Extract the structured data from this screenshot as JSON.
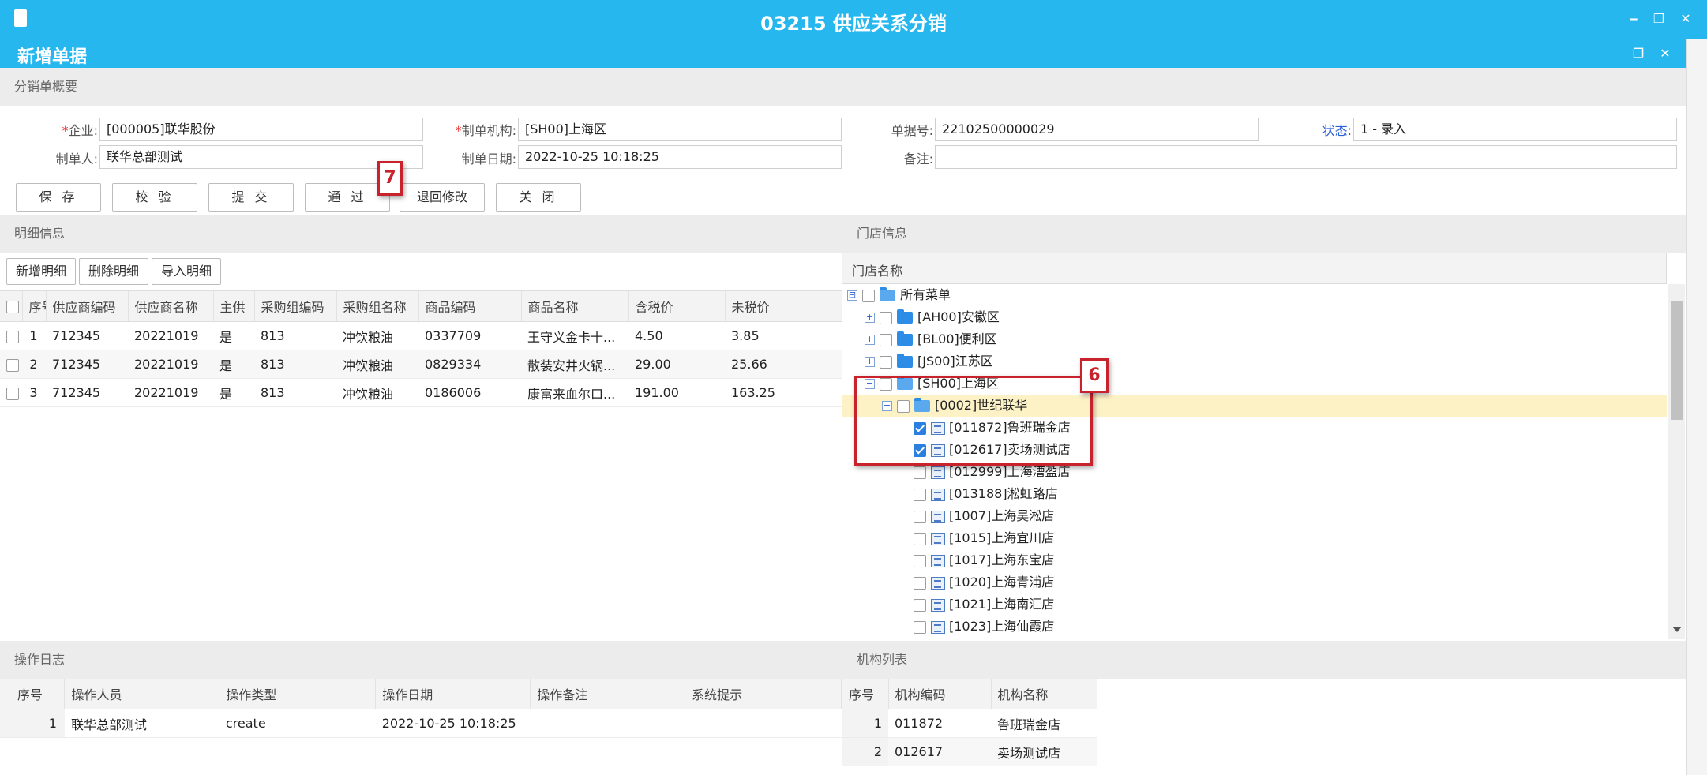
{
  "window": {
    "title": "03215 供应关系分销",
    "subtitle": "新增单据",
    "minimize_glyph": "‒",
    "restore_glyph": "❐",
    "close_glyph": "✕"
  },
  "summary": {
    "section_title": "分销单概要",
    "company_label": "企业:",
    "company_value": "[000005]联华股份",
    "org_label": "制单机构:",
    "org_value": "[SH00]上海区",
    "doc_no_label": "单据号:",
    "doc_no_value": "22102500000029",
    "status_label": "状态:",
    "status_value": "1 - 录入",
    "creator_label": "制单人:",
    "creator_value": "联华总部测试",
    "date_label": "制单日期:",
    "date_value": "2022-10-25 10:18:25",
    "remark_label": "备注:",
    "remark_value": ""
  },
  "toolbar": {
    "save": "保 存",
    "verify": "校 验",
    "submit": "提 交",
    "approve": "通 过",
    "reject": "退回修改",
    "close": "关 闭"
  },
  "detail": {
    "section_title": "明细信息",
    "add_button": "新增明细",
    "delete_button": "删除明细",
    "import_button": "导入明细",
    "columns": [
      "序号",
      "供应商编码",
      "供应商名称",
      "主供",
      "采购组编码",
      "采购组名称",
      "商品编码",
      "商品名称",
      "含税价",
      "未税价"
    ],
    "rows": [
      [
        "1",
        "712345",
        "20221019",
        "是",
        "813",
        "冲饮粮油",
        "0337709",
        "王守义金卡十...",
        "4.50",
        "3.85"
      ],
      [
        "2",
        "712345",
        "20221019",
        "是",
        "813",
        "冲饮粮油",
        "0829334",
        "散装安井火锅...",
        "29.00",
        "25.66"
      ],
      [
        "3",
        "712345",
        "20221019",
        "是",
        "813",
        "冲饮粮油",
        "0186006",
        "康富来血尔口...",
        "191.00",
        "163.25"
      ]
    ]
  },
  "store": {
    "section_title": "门店信息",
    "column": "门店名称",
    "tree": [
      {
        "label": "所有菜单",
        "level": 0,
        "type": "folder-open",
        "expander": "⊟",
        "checked": false
      },
      {
        "label": "[AH00]安徽区",
        "level": 1,
        "type": "folder",
        "expander": "+",
        "checked": false
      },
      {
        "label": "[BL00]便利区",
        "level": 1,
        "type": "folder",
        "expander": "+",
        "checked": false
      },
      {
        "label": "[JS00]江苏区",
        "level": 1,
        "type": "folder",
        "expander": "+",
        "checked": false
      },
      {
        "label": "[SH00]上海区",
        "level": 1,
        "type": "folder-open",
        "expander": "−",
        "checked": false
      },
      {
        "label": "[0002]世纪联华",
        "level": 2,
        "type": "folder-open",
        "expander": "−",
        "checked": false,
        "highlight": true
      },
      {
        "label": "[011872]鲁班瑞金店",
        "level": 3,
        "type": "leaf",
        "checked": true
      },
      {
        "label": "[012617]卖场测试店",
        "level": 3,
        "type": "leaf",
        "checked": true
      },
      {
        "label": "[012999]上海漕盈店",
        "level": 3,
        "type": "leaf",
        "checked": false
      },
      {
        "label": "[013188]淞虹路店",
        "level": 3,
        "type": "leaf",
        "checked": false
      },
      {
        "label": "[1007]上海吴淞店",
        "level": 3,
        "type": "leaf",
        "checked": false
      },
      {
        "label": "[1015]上海宜川店",
        "level": 3,
        "type": "leaf",
        "checked": false
      },
      {
        "label": "[1017]上海东宝店",
        "level": 3,
        "type": "leaf",
        "checked": false
      },
      {
        "label": "[1020]上海青浦店",
        "level": 3,
        "type": "leaf",
        "checked": false
      },
      {
        "label": "[1021]上海南汇店",
        "level": 3,
        "type": "leaf",
        "checked": false
      },
      {
        "label": "[1023]上海仙霞店",
        "level": 3,
        "type": "leaf",
        "checked": false
      }
    ]
  },
  "log": {
    "section_title": "操作日志",
    "columns": [
      "序号",
      "操作人员",
      "操作类型",
      "操作日期",
      "操作备注",
      "系统提示"
    ],
    "rows": [
      [
        "1",
        "联华总部测试",
        "create",
        "2022-10-25 10:18:25",
        "",
        ""
      ]
    ]
  },
  "orgs": {
    "section_title": "机构列表",
    "columns": [
      "序号",
      "机构编码",
      "机构名称"
    ],
    "rows": [
      [
        "1",
        "011872",
        "鲁班瑞金店"
      ],
      [
        "2",
        "012617",
        "卖场测试店"
      ]
    ]
  },
  "annotations": {
    "step6": "6",
    "step7": "7",
    "accent_color": "#c8232c"
  },
  "theme": {
    "header_color": "#26b7ef"
  }
}
